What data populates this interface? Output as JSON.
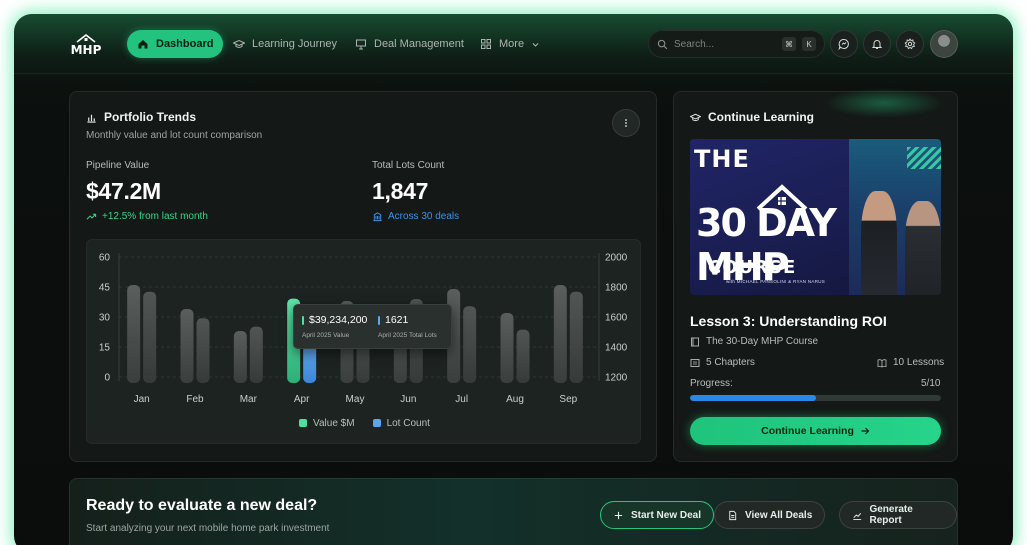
{
  "nav": {
    "logo_text": "MHP",
    "items": [
      {
        "label": "Dashboard",
        "icon": "home-icon",
        "active": true
      },
      {
        "label": "Learning Journey",
        "icon": "graduation-cap-icon",
        "active": false
      },
      {
        "label": "Deal Management",
        "icon": "presentation-icon",
        "active": false
      },
      {
        "label": "More",
        "icon": "grid-icon",
        "active": false
      }
    ],
    "search_placeholder": "Search...",
    "shortcut_keys": [
      "⌘",
      "K"
    ],
    "icons": [
      "chat-icon",
      "bell-icon",
      "gear-icon",
      "avatar"
    ]
  },
  "trends": {
    "title": "Portfolio Trends",
    "subtitle": "Monthly value and lot count comparison",
    "pipeline": {
      "label": "Pipeline Value",
      "value": "$47.2M",
      "change": "+12.5% from last month"
    },
    "lots": {
      "label": "Total Lots Count",
      "value": "1,847",
      "detail": "Across 30 deals"
    },
    "tooltip": {
      "value": "$39,234,200",
      "value_label": "April 2025 Value",
      "lots": "1621",
      "lots_label": "April 2025 Total Lots"
    }
  },
  "chart_data": {
    "type": "bar",
    "categories": [
      "Jan",
      "Feb",
      "Mar",
      "Apr",
      "May",
      "Jun",
      "Jul",
      "Aug",
      "Sep"
    ],
    "series": [
      {
        "name": "Value $M",
        "axis": "left",
        "values": [
          46,
          34,
          23,
          39.2,
          38,
          36,
          44,
          32,
          46
        ]
      },
      {
        "name": "Lot Count",
        "axis": "right",
        "values": [
          1768,
          1592,
          1536,
          1621,
          1520,
          1720,
          1672,
          1516,
          1768
        ]
      }
    ],
    "y_left": {
      "ticks": [
        0,
        15,
        30,
        45,
        60
      ],
      "ylim": [
        0,
        60
      ]
    },
    "y_right": {
      "ticks": [
        1200,
        1400,
        1600,
        1800,
        2000
      ],
      "ylim": [
        1200,
        2000
      ]
    },
    "highlighted_category": "Apr",
    "grid": true,
    "legend_position": "bottom",
    "colors": {
      "value": "#4fe0a0",
      "lots": "#5aa7f0",
      "muted": "#4a4f4d"
    }
  },
  "learning": {
    "title": "Continue Learning",
    "thumbnail": {
      "line1": "THE",
      "line2": "30 DAY MHP",
      "line3": "COURSE",
      "credits": "with MICHAEL PANSOLINI & RYAN NARUS"
    },
    "lesson_title": "Lesson 3: Understanding ROI",
    "course_name": "The 30-Day MHP Course",
    "chapters": "5 Chapters",
    "lessons": "10 Lessons",
    "progress_label": "Progress:",
    "progress_text": "5/10",
    "progress_fraction": 0.5,
    "button": "Continue Learning"
  },
  "cta": {
    "title": "Ready to evaluate a new deal?",
    "subtitle": "Start analyzing your next mobile home park investment",
    "buttons": [
      {
        "label": "Start New Deal",
        "icon": "plus-icon"
      },
      {
        "label": "View All Deals",
        "icon": "document-icon"
      },
      {
        "label": "Generate Report",
        "icon": "chart-line-icon"
      }
    ]
  }
}
